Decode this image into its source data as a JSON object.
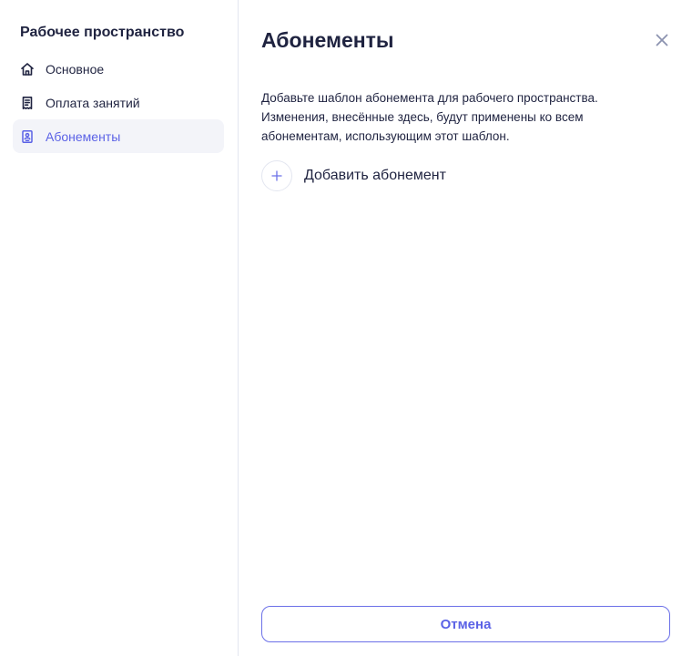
{
  "sidebar": {
    "title": "Рабочее пространство",
    "items": [
      {
        "label": "Основное",
        "icon": "home-icon",
        "active": false
      },
      {
        "label": "Оплата занятий",
        "icon": "receipt-icon",
        "active": false
      },
      {
        "label": "Абонементы",
        "icon": "badge-icon",
        "active": true
      }
    ]
  },
  "main": {
    "title": "Абонементы",
    "description_lines": [
      "Добавьте шаблон абонемента для рабочего пространства.",
      "Изменения, внесённые здесь, будут применены ко всем",
      "абонементам, использующим этот шаблон."
    ],
    "add_label": "Добавить абонемент",
    "cancel_label": "Отмена"
  },
  "icons": {
    "close": "close-icon",
    "add": "plus-icon"
  },
  "colors": {
    "accent": "#5b62e6",
    "text": "#1f2340",
    "active_bg": "#f3f4f9",
    "divider": "#e3e6f0"
  }
}
